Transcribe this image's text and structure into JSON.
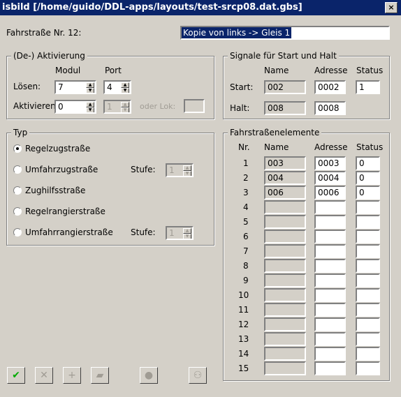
{
  "window": {
    "title": "isbild [/home/guido/DDL-apps/layouts/test-srcp08.dat.gbs]",
    "close": "×"
  },
  "route": {
    "label": "Fahrstraße Nr. 12:",
    "name_value": "Kopie von links -> Gleis 1"
  },
  "activation": {
    "legend": "(De-) Aktivierung",
    "col_modul": "Modul",
    "col_port": "Port",
    "loesen_label": "Lösen:",
    "loesen_modul": "7",
    "loesen_port": "4",
    "aktivieren_label": "Aktivieren",
    "aktivieren_modul": "0",
    "aktivieren_port": "1",
    "oder_lok": "oder Lok:"
  },
  "signals": {
    "legend": "Signale für Start und Halt",
    "col_name": "Name",
    "col_adresse": "Adresse",
    "col_status": "Status",
    "start_label": "Start:",
    "start_name": "002",
    "start_adresse": "0002",
    "start_status": "1",
    "halt_label": "Halt:",
    "halt_name": "008",
    "halt_adresse": "0008"
  },
  "typ": {
    "legend": "Typ",
    "opt1": "Regelzugstraße",
    "opt2": "Umfahrzugstraße",
    "opt3": "Zughilfsstraße",
    "opt4": "Regelrangierstraße",
    "opt5": "Umfahrrangierstraße",
    "stufe_label": "Stufe:",
    "stufe1": "1",
    "stufe2": "1",
    "selected": "opt1"
  },
  "elements": {
    "legend": "Fahrstraßenelemente",
    "col_nr": "Nr.",
    "col_name": "Name",
    "col_adresse": "Adresse",
    "col_status": "Status",
    "rows": [
      {
        "nr": "1",
        "name": "003",
        "adresse": "0003",
        "status": "0"
      },
      {
        "nr": "2",
        "name": "004",
        "adresse": "0004",
        "status": "0"
      },
      {
        "nr": "3",
        "name": "006",
        "adresse": "0006",
        "status": "0"
      },
      {
        "nr": "4",
        "name": "",
        "adresse": "",
        "status": ""
      },
      {
        "nr": "5",
        "name": "",
        "adresse": "",
        "status": ""
      },
      {
        "nr": "6",
        "name": "",
        "adresse": "",
        "status": ""
      },
      {
        "nr": "7",
        "name": "",
        "adresse": "",
        "status": ""
      },
      {
        "nr": "8",
        "name": "",
        "adresse": "",
        "status": ""
      },
      {
        "nr": "9",
        "name": "",
        "adresse": "",
        "status": ""
      },
      {
        "nr": "10",
        "name": "",
        "adresse": "",
        "status": ""
      },
      {
        "nr": "11",
        "name": "",
        "adresse": "",
        "status": ""
      },
      {
        "nr": "12",
        "name": "",
        "adresse": "",
        "status": ""
      },
      {
        "nr": "13",
        "name": "",
        "adresse": "",
        "status": ""
      },
      {
        "nr": "14",
        "name": "",
        "adresse": "",
        "status": ""
      },
      {
        "nr": "15",
        "name": "",
        "adresse": "",
        "status": ""
      }
    ]
  },
  "toolbar": {
    "ok_icon": "check-icon",
    "cancel_icon": "x-icon",
    "add_icon": "plus-icon",
    "copy_icon": "copy-icon",
    "record_icon": "dot-icon",
    "view_icon": "glasses-icon"
  }
}
